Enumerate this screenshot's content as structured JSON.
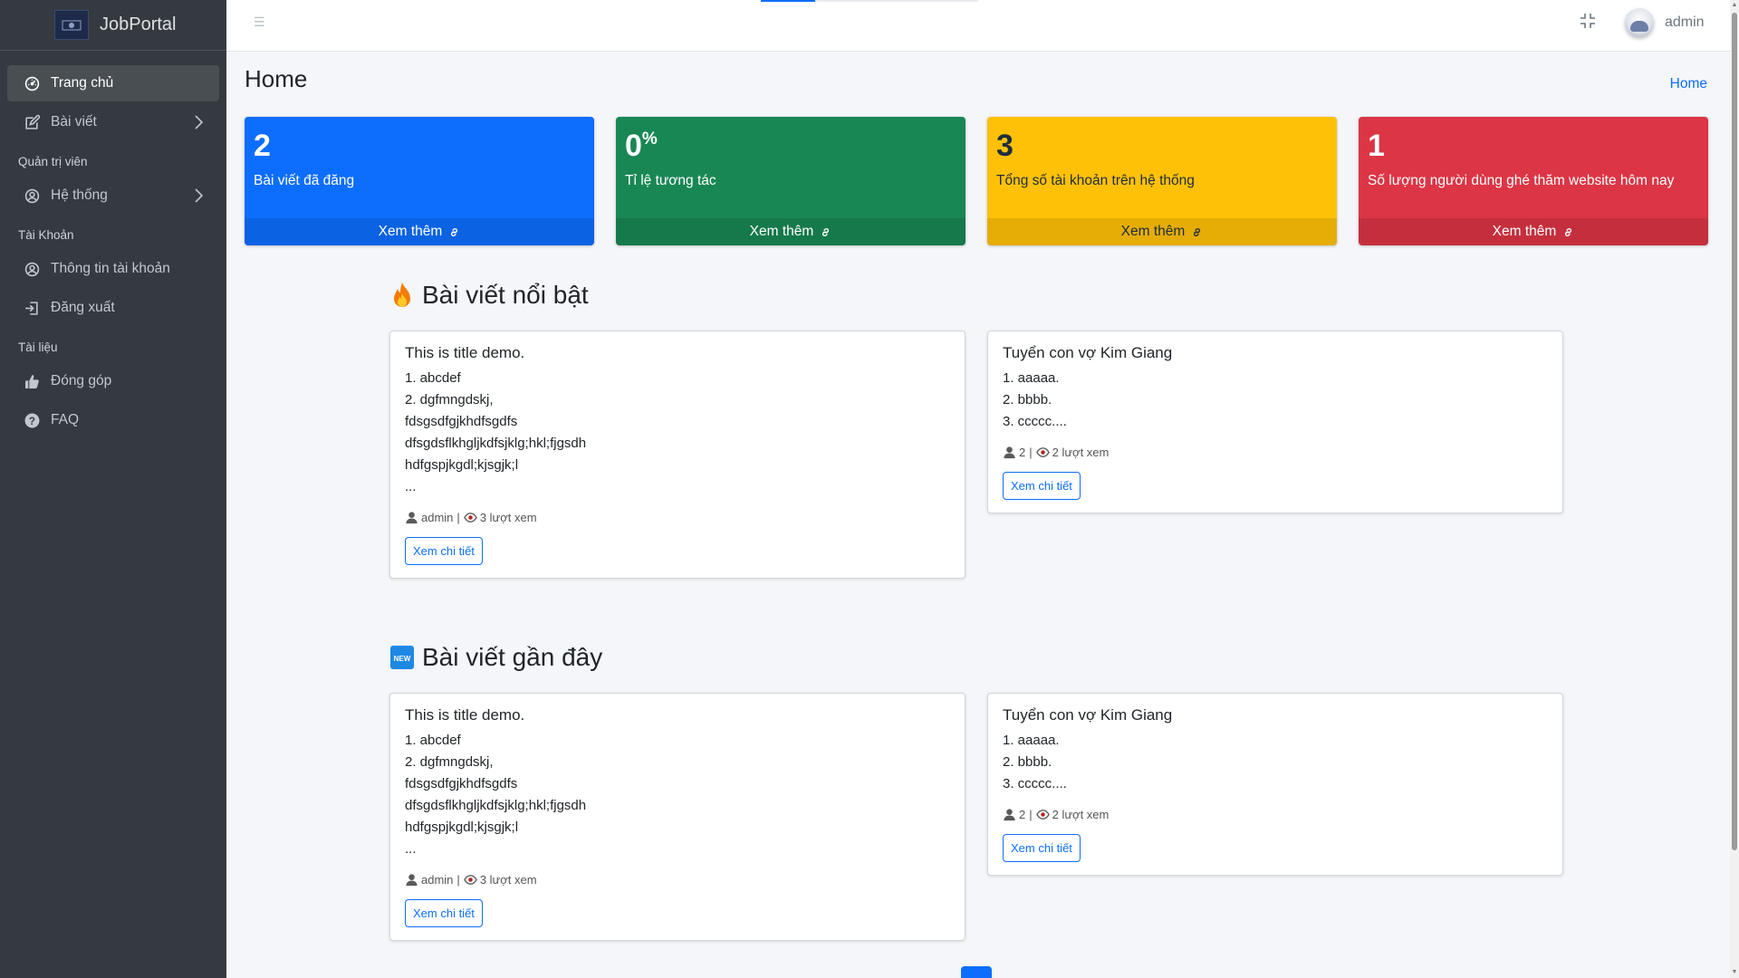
{
  "brand": {
    "name": "JobPortal"
  },
  "sidebar": {
    "items": [
      {
        "type": "item",
        "label": "Trang chủ",
        "icon": "dashboard-icon",
        "active": true,
        "chevron": false
      },
      {
        "type": "item",
        "label": "Bài viết",
        "icon": "edit-icon",
        "active": false,
        "chevron": true
      },
      {
        "type": "header",
        "label": "Quản trị viên"
      },
      {
        "type": "item",
        "label": "Hệ thống",
        "icon": "user-circle-icon",
        "active": false,
        "chevron": true
      },
      {
        "type": "header",
        "label": "Tài Khoản"
      },
      {
        "type": "item",
        "label": "Thông tin tài khoản",
        "icon": "user-circle-icon",
        "active": false,
        "chevron": false
      },
      {
        "type": "item",
        "label": "Đăng xuất",
        "icon": "logout-icon",
        "active": false,
        "chevron": false
      },
      {
        "type": "header",
        "label": "Tài liệu"
      },
      {
        "type": "item",
        "label": "Đóng góp",
        "icon": "thumbs-up-icon",
        "active": false,
        "chevron": false
      },
      {
        "type": "item",
        "label": "FAQ",
        "icon": "question-circle-icon",
        "active": false,
        "chevron": false
      }
    ]
  },
  "topbar": {
    "menu_icon": "hamburger-icon",
    "fullscreen_icon": "compress-icon",
    "username": "admin",
    "loading_progress": 0.25
  },
  "page": {
    "title": "Home",
    "breadcrumb": "Home"
  },
  "stats": [
    {
      "value": "2",
      "suffix": "",
      "label": "Bài viết đã đăng",
      "more": "Xem thêm",
      "color": "#0d6efd"
    },
    {
      "value": "0",
      "suffix": "%",
      "label": "Tỉ lệ tương tác",
      "more": "Xem thêm",
      "color": "#198754"
    },
    {
      "value": "3",
      "suffix": "",
      "label": "Tổng số tài khoản trên hệ thống",
      "more": "Xem thêm",
      "color": "#ffc107"
    },
    {
      "value": "1",
      "suffix": "",
      "label": "Số lượng người dùng ghé thăm website hôm nay",
      "more": "Xem thêm",
      "color": "#dc3545"
    }
  ],
  "sections": [
    {
      "title": "Bài viết nổi bật",
      "icon": "fire-icon",
      "posts": [
        {
          "title": "This is title demo.",
          "lines": [
            "1. abcdef",
            "2. dgfmngdskj,",
            "fdsgsdfgjkhdfsgdfs",
            "dfsgdsflkhgljkdfsjklg;hkl;fjgsdh",
            "hdfgspjkgdl;kjsgjk;l",
            "..."
          ],
          "author": "admin",
          "views": "3 lượt xem",
          "button": "Xem chi tiết"
        },
        {
          "title": "Tuyển con vợ Kim Giang",
          "lines": [
            "1. aaaaa.",
            "2. bbbb.",
            "3. ccccc...."
          ],
          "author": "2",
          "views": "2 lượt xem",
          "button": "Xem chi tiết"
        }
      ]
    },
    {
      "title": "Bài viết gần đây",
      "icon": "new-badge-icon",
      "posts": [
        {
          "title": "This is title demo.",
          "lines": [
            "1. abcdef",
            "2. dgfmngdskj,",
            "fdsgsdfgjkhdfsgdfs",
            "dfsgdsflkhgljkdfsjklg;hkl;fjgsdh",
            "hdfgspjkgdl;kjsgjk;l",
            "..."
          ],
          "author": "admin",
          "views": "3 lượt xem",
          "button": "Xem chi tiết"
        },
        {
          "title": "Tuyển con vợ Kim Giang",
          "lines": [
            "1. aaaaa.",
            "2. bbbb.",
            "3. ccccc...."
          ],
          "author": "2",
          "views": "2 lượt xem",
          "button": "Xem chi tiết"
        }
      ]
    }
  ]
}
